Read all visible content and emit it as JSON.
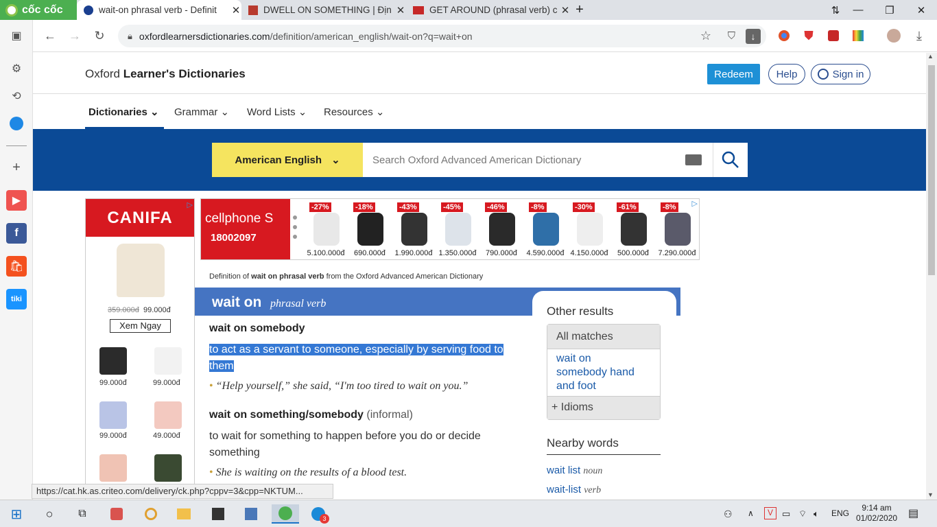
{
  "browser": {
    "brand": "cốc cốc",
    "tabs": [
      {
        "title": "wait-on phrasal verb - Definit",
        "active": true
      },
      {
        "title": "DWELL ON SOMETHING | Địn",
        "active": false
      },
      {
        "title": "GET AROUND (phrasal verb) c",
        "active": false
      }
    ],
    "new_tab": "+",
    "url_domain": "oxfordlearnersdictionaries.com",
    "url_path": "/definition/american_english/wait-on?q=wait+on"
  },
  "site": {
    "logo_prefix": "Oxford",
    "logo_bold": "Learner's Dictionaries",
    "redeem": "Redeem",
    "help": "Help",
    "signin": "Sign in",
    "nav": [
      "Dictionaries",
      "Grammar",
      "Word Lists",
      "Resources"
    ],
    "language": "American English",
    "search_placeholder": "Search Oxford Advanced American Dictionary"
  },
  "ads": {
    "canifa": {
      "brand": "CANIFA",
      "old_price": "359.000đ",
      "new_price": "99.000đ",
      "cta": "Xem Ngay",
      "prices": [
        "99.000đ",
        "99.000đ",
        "99.000đ",
        "49.000đ"
      ]
    },
    "cellphones": {
      "brand": "cellphone S",
      "phone": "18002097",
      "items": [
        {
          "discount": "-27%",
          "price": "5.100.000đ",
          "color": "#e8e8e8"
        },
        {
          "discount": "-18%",
          "price": "690.000đ",
          "color": "#222222"
        },
        {
          "discount": "-43%",
          "price": "1.990.000đ",
          "color": "#333333"
        },
        {
          "discount": "-45%",
          "price": "1.350.000đ",
          "color": "#dde3ea"
        },
        {
          "discount": "-46%",
          "price": "790.000đ",
          "color": "#2a2a2a"
        },
        {
          "discount": "-8%",
          "price": "4.590.000đ",
          "color": "#2f6fa8"
        },
        {
          "discount": "-30%",
          "price": "4.150.000đ",
          "color": "#eeeeee"
        },
        {
          "discount": "-61%",
          "price": "500.000đ",
          "color": "#333333"
        },
        {
          "discount": "-8%",
          "price": "7.290.000đ",
          "color": "#5a5a6a"
        }
      ]
    }
  },
  "entry": {
    "def_from_pre": "Definition of",
    "def_from_word": "wait on phrasal verb",
    "def_from_post": "from the Oxford Advanced American Dictionary",
    "headword": "wait on",
    "pos": "phrasal verb",
    "senses": [
      {
        "title": "wait on somebody",
        "def_line1": "to act as a servant to someone, especially by serving food to",
        "def_line2": "them",
        "example": "“Help yourself,” she said, “I'm too tired to wait on you.”"
      },
      {
        "title": "wait on something/somebody",
        "label": "(informal)",
        "def_line1": "to wait for something to happen before you do or decide",
        "def_line2": "something",
        "example": "She is waiting on the results of a blood test."
      }
    ]
  },
  "other_results": {
    "title": "Other results",
    "all_matches": "All matches",
    "match_lines": [
      "wait on",
      "somebody hand",
      "and foot"
    ],
    "idioms": "Idioms"
  },
  "nearby": {
    "title": "Nearby words",
    "items": [
      {
        "word": "wait list",
        "pos": "noun"
      },
      {
        "word": "wait-list",
        "pos": "verb"
      }
    ]
  },
  "status_url": "https://cat.hk.as.criteo.com/delivery/ck.php?cppv=3&cpp=NKTUM...",
  "taskbar": {
    "lang": "ENG",
    "time": "9:14 am",
    "date": "01/02/2020",
    "badge": "3"
  }
}
